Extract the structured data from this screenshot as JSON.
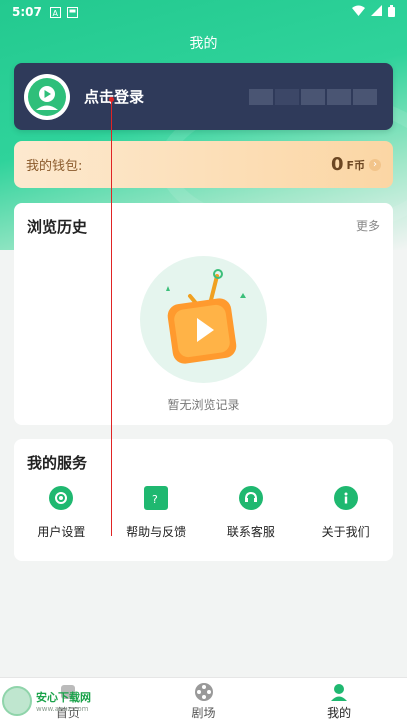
{
  "status_bar": {
    "time": "5:07"
  },
  "header": {
    "title": "我的"
  },
  "login": {
    "label": "点击登录"
  },
  "wallet": {
    "label": "我的钱包:",
    "amount": "0",
    "unit": "F币"
  },
  "history": {
    "title": "浏览历史",
    "more": "更多",
    "empty_text": "暂无浏览记录"
  },
  "services": {
    "title": "我的服务",
    "items": [
      {
        "label": "用户设置",
        "icon": "settings-icon"
      },
      {
        "label": "帮助与反馈",
        "icon": "help-icon"
      },
      {
        "label": "联系客服",
        "icon": "headset-icon"
      },
      {
        "label": "关于我们",
        "icon": "info-icon"
      }
    ]
  },
  "tabbar": {
    "items": [
      {
        "label": "首页",
        "icon": "home-icon"
      },
      {
        "label": "剧场",
        "icon": "film-reel-icon"
      },
      {
        "label": "我的",
        "icon": "profile-icon"
      }
    ],
    "active_index": 2
  },
  "watermark": {
    "title": "安心下载网",
    "sub": "www.anxz.com"
  },
  "colors": {
    "accent": "#1fb870",
    "login_card": "#2f3a5a",
    "wallet_text": "#6b4622"
  }
}
